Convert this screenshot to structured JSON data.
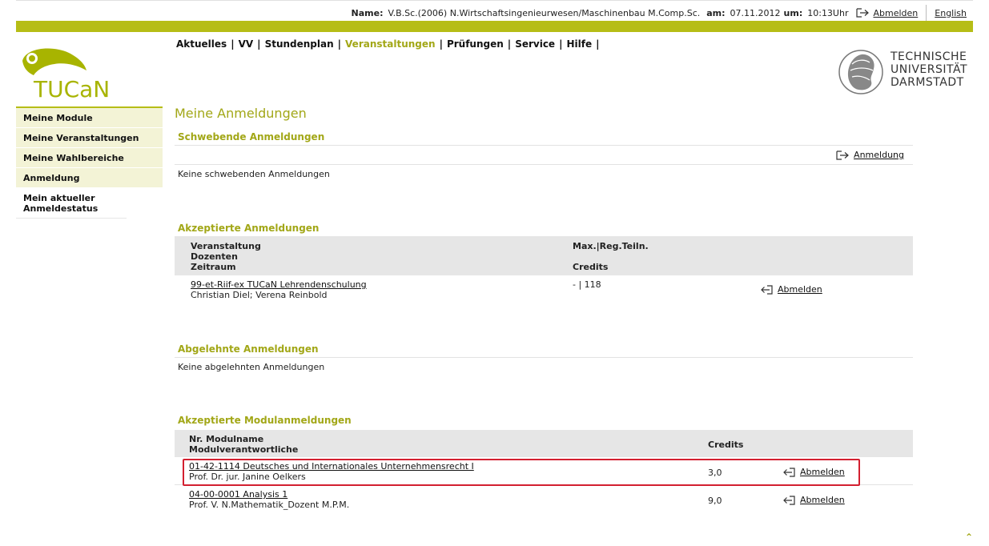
{
  "header": {
    "name_label": "Name:",
    "name_value": "V.B.Sc.(2006) N.Wirtschaftsingenieurwesen/Maschinenbau M.Comp.Sc.",
    "am_label": "am:",
    "date": "07.11.2012",
    "um_label": "um:",
    "time": "10:13Uhr",
    "logout": "Abmelden",
    "language": "English"
  },
  "nav": [
    "Aktuelles",
    "VV",
    "Stundenplan",
    "Veranstaltungen",
    "Prüfungen",
    "Service",
    "Hilfe"
  ],
  "logo_text": "TUCaN",
  "university": [
    "TECHNISCHE",
    "UNIVERSITÄT",
    "DARMSTADT"
  ],
  "sidebar": [
    "Meine Module",
    "Meine Veranstaltungen",
    "Meine Wahlbereiche",
    "Anmeldung",
    "Mein aktueller Anmeldestatus"
  ],
  "page_title": "Meine Anmeldungen",
  "pending": {
    "heading": "Schwebende Anmeldungen",
    "action": "Anmeldung",
    "empty": "Keine schwebenden Anmeldungen"
  },
  "accepted": {
    "heading": "Akzeptierte Anmeldungen",
    "col1": [
      "Veranstaltung",
      "Dozenten",
      "Zeitraum"
    ],
    "col2": [
      "Max.|Reg.Teiln.",
      "Credits"
    ],
    "rows": [
      {
        "title": "99-et-Riif-ex TUCaN Lehrendenschulung",
        "lecturers": "Christian Diel; Verena Reinbold",
        "max": "- | 118",
        "action": "Abmelden"
      }
    ]
  },
  "rejected": {
    "heading": "Abgelehnte Anmeldungen",
    "empty": "Keine abgelehnten Anmeldungen"
  },
  "modules": {
    "heading": "Akzeptierte Modulanmeldungen",
    "col1": [
      "Nr. Modulname",
      "Modulverantwortliche"
    ],
    "col2": "Credits",
    "rows": [
      {
        "title": "01-42-1114 Deutsches und Internationales Unternehmensrecht I",
        "responsible": "Prof. Dr. jur. Janine Oelkers",
        "credits": "3,0",
        "action": "Abmelden"
      },
      {
        "title": "04-00-0001 Analysis 1",
        "responsible": "Prof. V. N.Mathematik_Dozent M.P.M.",
        "credits": "9,0",
        "action": "Abmelden"
      }
    ]
  },
  "colors": {
    "accent": "#b6bd16",
    "heading": "#a2a717",
    "highlight": "#d32030"
  }
}
